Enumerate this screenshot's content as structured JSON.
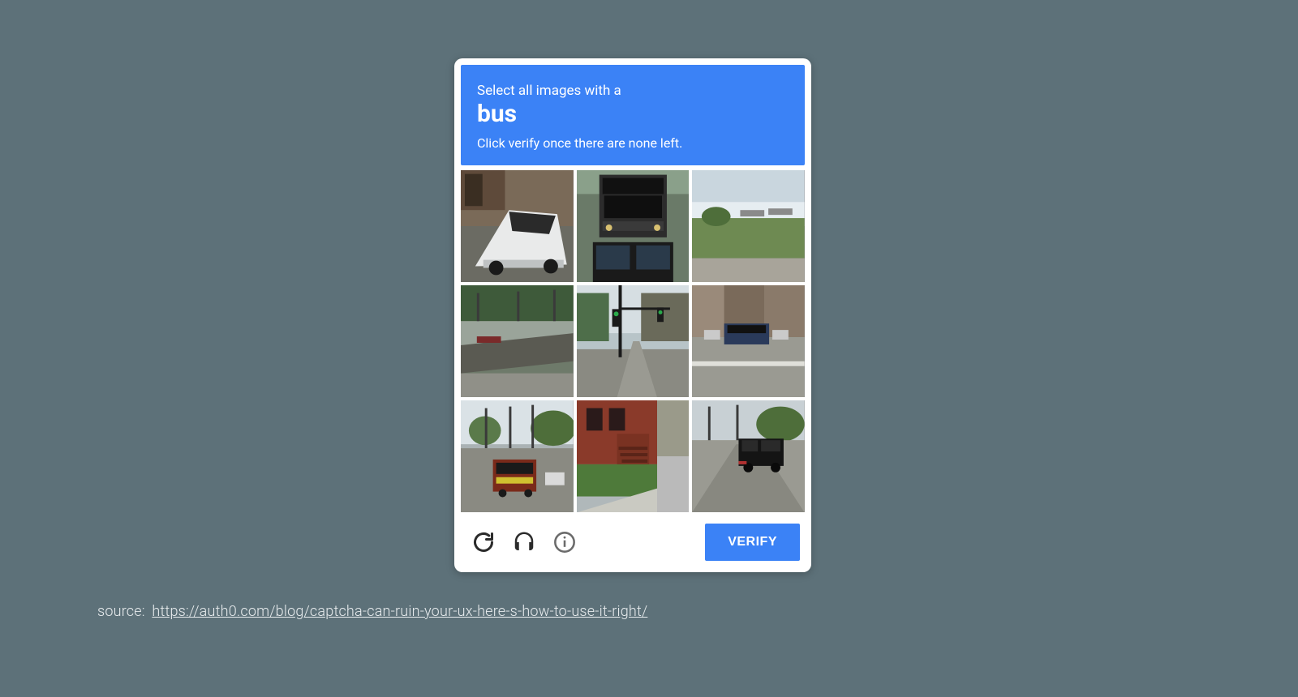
{
  "captcha": {
    "instruction_line1": "Select all images with a",
    "target_word": "bus",
    "instruction_line2": "Click verify once there are none left.",
    "verify_label": "VERIFY",
    "tiles": [
      {
        "alt": "white-minivan"
      },
      {
        "alt": "bus-front"
      },
      {
        "alt": "roadside-grass"
      },
      {
        "alt": "highway-barrier"
      },
      {
        "alt": "traffic-light-intersection"
      },
      {
        "alt": "city-street-bus"
      },
      {
        "alt": "street-with-bus"
      },
      {
        "alt": "brick-house-steps"
      },
      {
        "alt": "black-suv-road"
      }
    ]
  },
  "source": {
    "label": "source:",
    "url": "https://auth0.com/blog/captcha-can-ruin-your-ux-here-s-how-to-use-it-right/"
  }
}
